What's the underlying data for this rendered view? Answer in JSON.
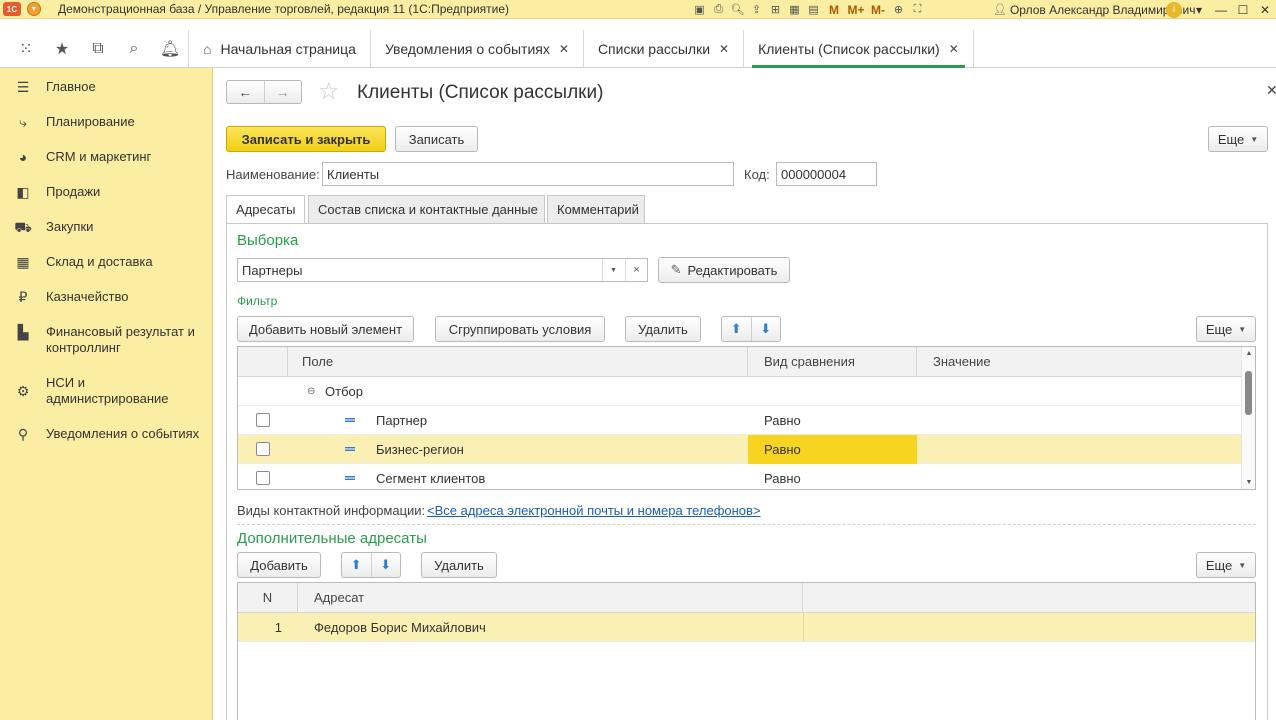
{
  "app": {
    "logo_text": "1С",
    "title": "Демонстрационная база / Управление торговлей, редакция 11  (1С:Предприятие)",
    "user": "Орлов Александр Владимирович",
    "toolbar_m": [
      "M",
      "M+",
      "M-"
    ]
  },
  "tabs": [
    {
      "label": "Начальная страница",
      "closable": false
    },
    {
      "label": "Уведомления о событиях",
      "closable": true
    },
    {
      "label": "Списки рассылки",
      "closable": true
    },
    {
      "label": "Клиенты (Список рассылки)",
      "closable": true,
      "active": true
    }
  ],
  "sidebar": {
    "items": [
      {
        "label": "Главное",
        "icon": "menu-lines-icon"
      },
      {
        "label": "Планирование",
        "icon": "planning-icon"
      },
      {
        "label": "CRM и маркетинг",
        "icon": "crm-icon"
      },
      {
        "label": "Продажи",
        "icon": "bag-icon"
      },
      {
        "label": "Закупки",
        "icon": "cart-icon"
      },
      {
        "label": "Склад и доставка",
        "icon": "warehouse-icon"
      },
      {
        "label": "Казначейство",
        "icon": "ruble-icon"
      },
      {
        "label": "Финансовый результат и\nконтроллинг",
        "icon": "bar-chart-icon"
      },
      {
        "label": "НСИ и\nадминистрирование",
        "icon": "gear-icon"
      },
      {
        "label": "Уведомления о событиях",
        "icon": "notification-icon"
      }
    ]
  },
  "form": {
    "title": "Клиенты (Список рассылки)",
    "save_close": "Записать и закрыть",
    "save": "Записать",
    "more": "Еще",
    "name_label": "Наименование:",
    "name_value": "Клиенты",
    "code_label": "Код:",
    "code_value": "000000004",
    "inner_tabs": [
      "Адресаты",
      "Состав списка и контактные данные",
      "Комментарий"
    ],
    "selection_title": "Выборка",
    "selection_value": "Партнеры",
    "edit_button": "Редактировать",
    "filter_title": "Фильтр",
    "add_element": "Добавить новый элемент",
    "group_conditions": "Сгруппировать условия",
    "delete": "Удалить",
    "filter_grid": {
      "columns": [
        "Поле",
        "Вид сравнения",
        "Значение"
      ],
      "group_row": "Отбор",
      "rows": [
        {
          "field": "Партнер",
          "comparison": "Равно",
          "value": "",
          "selected": false
        },
        {
          "field": "Бизнес-регион",
          "comparison": "Равно",
          "value": "",
          "selected": true
        },
        {
          "field": "Сегмент клиентов",
          "comparison": "Равно",
          "value": "",
          "selected": false
        }
      ]
    },
    "contact_types_label": "Виды контактной информации:",
    "contact_types_link": "<Все адреса электронной почты и номера телефонов>",
    "extra_title": "Дополнительные адресаты",
    "add": "Добавить",
    "extra_grid": {
      "columns": [
        "N",
        "Адресат"
      ],
      "rows": [
        {
          "n": "1",
          "addressee": "Федоров Борис Михайлович"
        }
      ]
    }
  }
}
